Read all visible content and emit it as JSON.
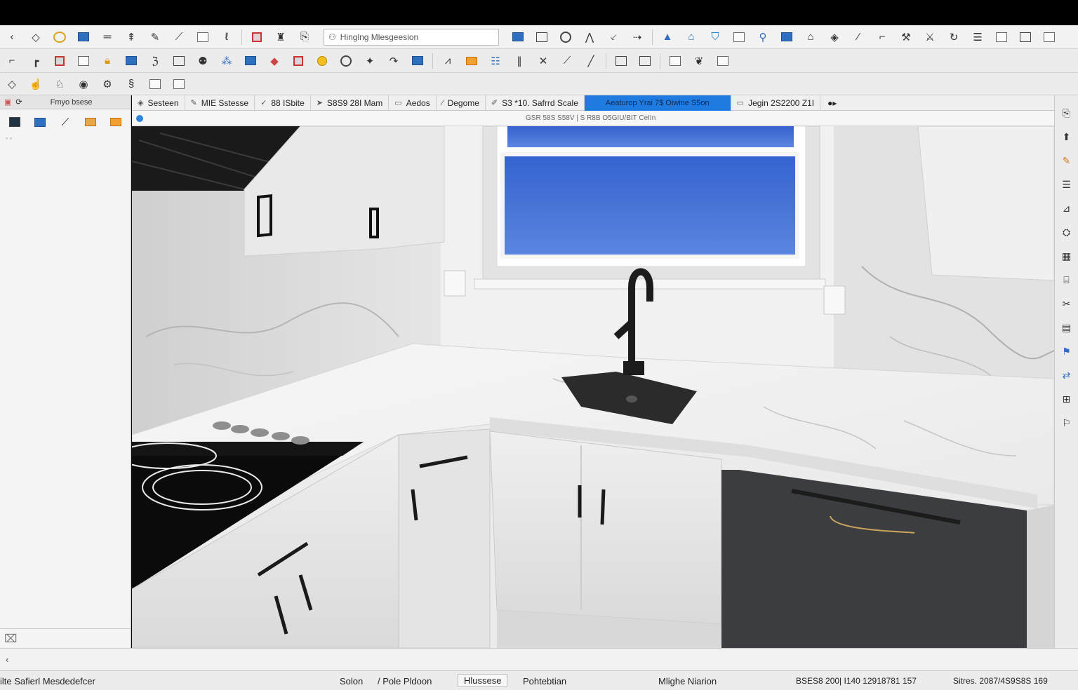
{
  "toolbar_top": {
    "search_text": "Hinglng Mlesgeesion",
    "search_icon": "binoculars-icon"
  },
  "left_panel": {
    "header": "Fmyo bsese",
    "header_icon": "tray-icon"
  },
  "tabs": [
    {
      "label": "Sesteen",
      "icon": "paint-bucket-icon"
    },
    {
      "label": "MIE Sstesse",
      "icon": "pencil-icon"
    },
    {
      "label": "88 ISbite",
      "icon": "check-icon"
    },
    {
      "label": "S8S9 28I Mam",
      "icon": "cursor-icon"
    },
    {
      "label": "Aedos",
      "icon": "monitor-icon"
    },
    {
      "label": "Degome",
      "icon": "slash-icon"
    },
    {
      "label": "S3 *10. Safrrd Scale",
      "icon": "pen-icon"
    },
    {
      "label": "Aeaturop Yrai 7$ Oiwine S5on",
      "icon": ""
    },
    {
      "label": "Jegin 2S2200 Z1I",
      "icon": "monitor-icon"
    }
  ],
  "subbar": {
    "text": "GSR 58S S58V  |  S R8B O5GIU/BIT CeIIn"
  },
  "statusbar": {
    "left": "ilte Safierl Mesdedefcer",
    "solon": "Solon",
    "pole": "/ Pole Pldoon",
    "hussese": "Hlussese",
    "pohtebtian": "Pohtebtian",
    "mlighe": "Mlighe Niarion",
    "coords": "BSES8 200| I140 12918781 157",
    "sitres": "Sitres. 2087/4S9S8S 169"
  },
  "cmdline": {
    "prompt_icon": "chevron-left-icon"
  },
  "colors": {
    "active_tab": "#1f7be0",
    "cabinet_dark": "#3c3d40",
    "window_sky": "#3d6fd6"
  }
}
